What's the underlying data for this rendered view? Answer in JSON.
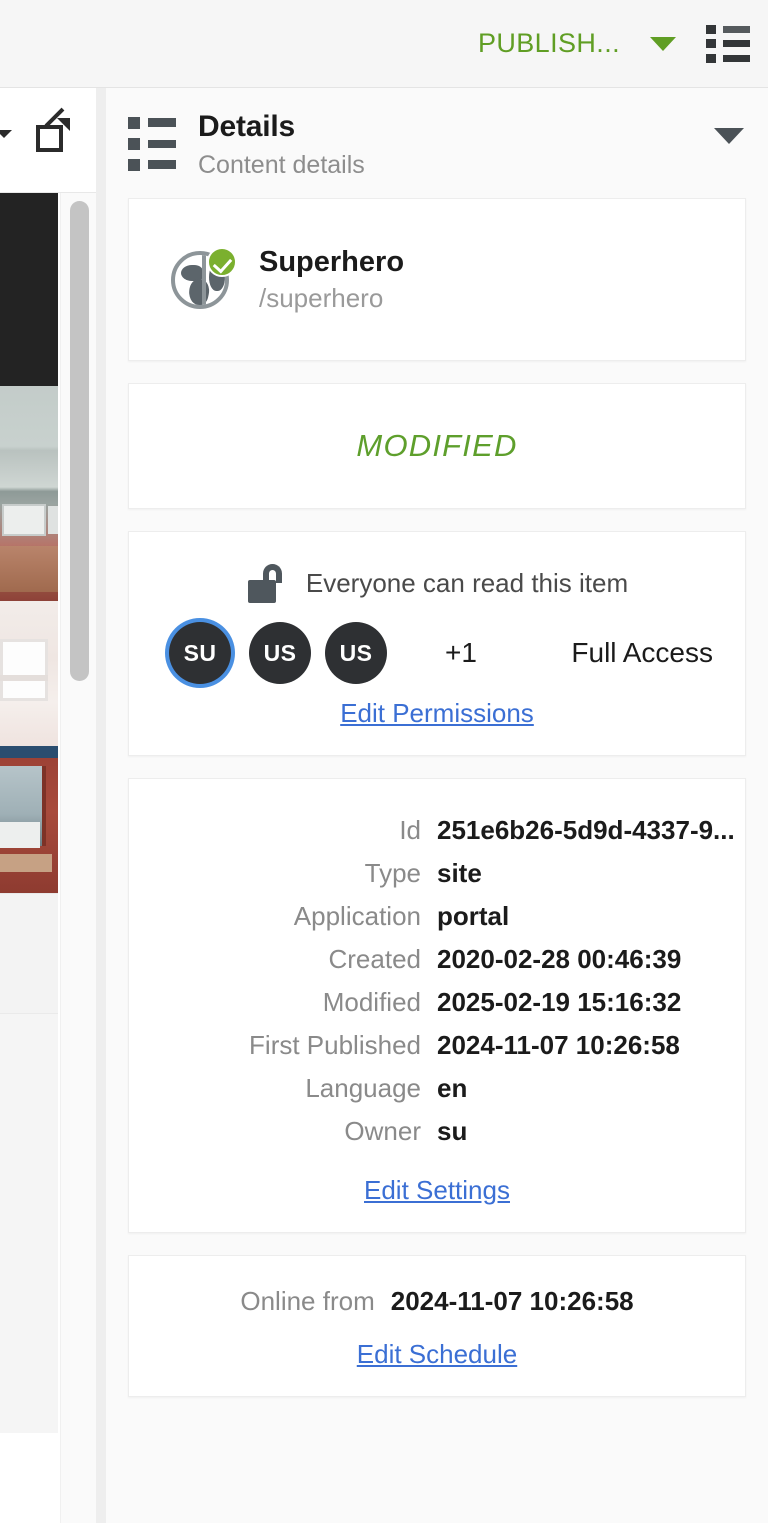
{
  "topbar": {
    "publish_label": "PUBLISH...",
    "publish_color": "#609e24",
    "dropdown_icon": "caret-down-icon",
    "list_icon": "details-list-icon"
  },
  "left_strip": {
    "external_link_icon": "external-link-icon",
    "scrollbar": "vertical-scrollbar"
  },
  "panel": {
    "icon": "details-list-icon",
    "title": "Details",
    "subtitle": "Content details",
    "collapse_icon": "caret-down-icon"
  },
  "content": {
    "icon": "globe-online-icon",
    "name": "Superhero",
    "path": "/superhero"
  },
  "status": {
    "label": "MODIFIED",
    "color": "#5e9f2c"
  },
  "permissions": {
    "lock_icon": "unlocked-padlock-icon",
    "summary": "Everyone can read this item",
    "avatars": [
      {
        "initials": "SU",
        "selected": true
      },
      {
        "initials": "US",
        "selected": false
      },
      {
        "initials": "US",
        "selected": false
      }
    ],
    "overflow_count": "+1",
    "access_level": "Full Access",
    "edit_link": "Edit Permissions"
  },
  "metadata": {
    "rows": [
      {
        "label": "Id",
        "value": "251e6b26-5d9d-4337-9..."
      },
      {
        "label": "Type",
        "value": "site"
      },
      {
        "label": "Application",
        "value": "portal"
      },
      {
        "label": "Created",
        "value": "2020-02-28 00:46:39"
      },
      {
        "label": "Modified",
        "value": "2025-02-19 15:16:32"
      },
      {
        "label": "First Published",
        "value": "2024-11-07 10:26:58"
      },
      {
        "label": "Language",
        "value": "en"
      },
      {
        "label": "Owner",
        "value": "su"
      }
    ],
    "edit_link": "Edit Settings"
  },
  "schedule": {
    "label": "Online from",
    "value": "2024-11-07 10:26:58",
    "edit_link": "Edit Schedule"
  }
}
